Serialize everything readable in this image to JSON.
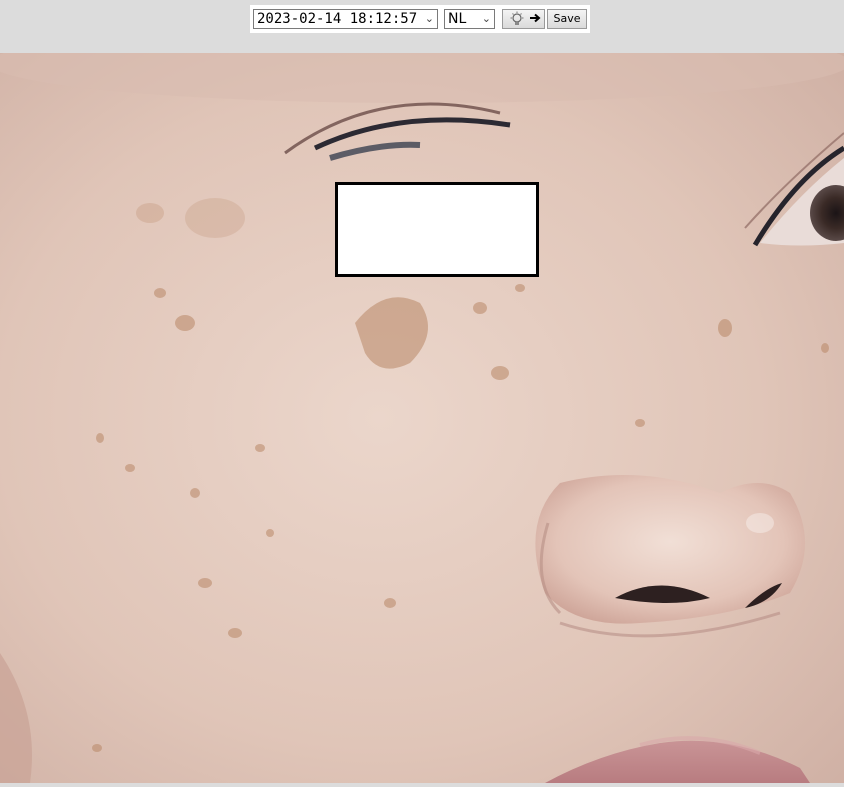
{
  "toolbar": {
    "datetime_value": "2023-02-14 18:12:57",
    "language_value": "NL",
    "light_icon": "light-bulb-arrow-icon",
    "save_label": "Save"
  },
  "photo": {
    "subject": "close-up facial skin image",
    "colors": {
      "skin": "#e2c7bb",
      "spots": "#c79a7a",
      "lips": "#c78e8e",
      "eye": "#2a2226"
    }
  },
  "redaction": {
    "color": "#ffffff"
  }
}
